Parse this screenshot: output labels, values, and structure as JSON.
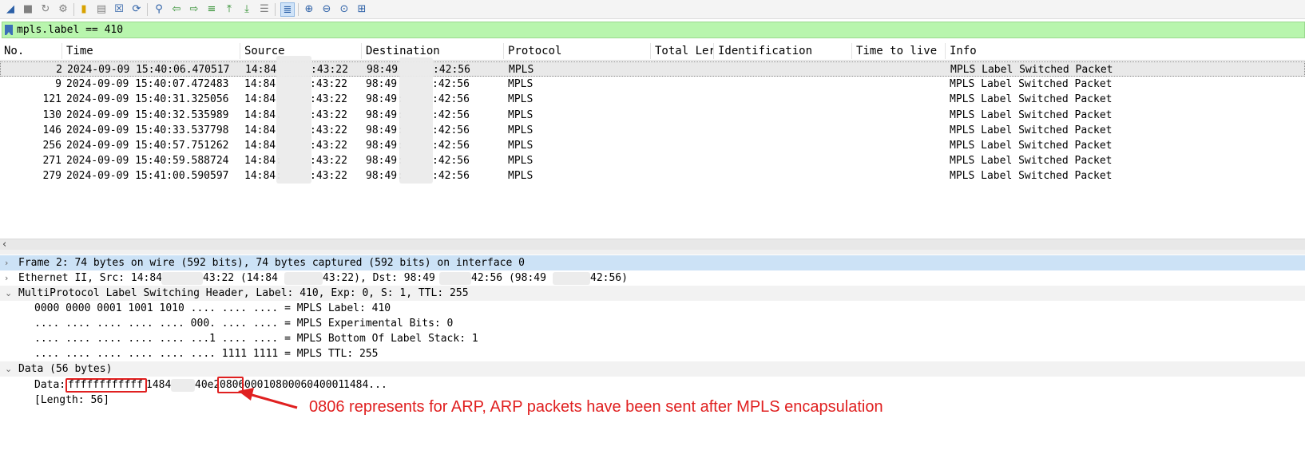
{
  "toolbar": {
    "icons": [
      "shark-fin-icon",
      "stop-icon",
      "restart-icon",
      "options-icon",
      "open-icon",
      "save-icon",
      "close-file-icon",
      "reload-icon",
      "find-icon",
      "back-icon",
      "forward-icon",
      "goto-icon",
      "first-icon",
      "last-icon",
      "autoscroll-icon",
      "colorize-icon",
      "zoom-in-icon",
      "zoom-out-icon",
      "zoom-normal-icon",
      "resize-columns-icon"
    ]
  },
  "filter": {
    "value": "mpls.label == 410"
  },
  "packet_list": {
    "columns": [
      "No.",
      "Time",
      "Source",
      "Destination",
      "Protocol",
      "Total Ler",
      "Identification",
      "Time to live",
      "Info"
    ],
    "rows": [
      {
        "no": "2",
        "time": "2024-09-09 15:40:06.470517",
        "src_a": "14:84",
        "src_b": ":43:22",
        "dst_a": "98:49",
        "dst_b": ":42:56",
        "proto": "MPLS",
        "info": "MPLS Label Switched Packet"
      },
      {
        "no": "9",
        "time": "2024-09-09 15:40:07.472483",
        "src_a": "14:84",
        "src_b": ":43:22",
        "dst_a": "98:49",
        "dst_b": ":42:56",
        "proto": "MPLS",
        "info": "MPLS Label Switched Packet"
      },
      {
        "no": "121",
        "time": "2024-09-09 15:40:31.325056",
        "src_a": "14:84",
        "src_b": ":43:22",
        "dst_a": "98:49:",
        "dst_b": ":42:56",
        "proto": "MPLS",
        "info": "MPLS Label Switched Packet"
      },
      {
        "no": "130",
        "time": "2024-09-09 15:40:32.535989",
        "src_a": "14:84.",
        "src_b": ":43:22",
        "dst_a": "98:49:",
        "dst_b": ":42:56",
        "proto": "MPLS",
        "info": "MPLS Label Switched Packet"
      },
      {
        "no": "146",
        "time": "2024-09-09 15:40:33.537798",
        "src_a": "14:84",
        "src_b": ":43:22",
        "dst_a": "98:49:",
        "dst_b": ":42:56",
        "proto": "MPLS",
        "info": "MPLS Label Switched Packet"
      },
      {
        "no": "256",
        "time": "2024-09-09 15:40:57.751262",
        "src_a": "14:84",
        "src_b": ":43:22",
        "dst_a": "98:49:",
        "dst_b": ":42:56",
        "proto": "MPLS",
        "info": "MPLS Label Switched Packet"
      },
      {
        "no": "271",
        "time": "2024-09-09 15:40:59.588724",
        "src_a": "14:84:",
        "src_b": ":43:22",
        "dst_a": "98:49:",
        "dst_b": ":42:56",
        "proto": "MPLS",
        "info": "MPLS Label Switched Packet"
      },
      {
        "no": "279",
        "time": "2024-09-09 15:41:00.590597",
        "src_a": "14:84:",
        "src_b": ":43:22",
        "dst_a": "98:49:",
        "dst_b": ":42:56",
        "proto": "MPLS",
        "info": "MPLS Label Switched Packet"
      }
    ]
  },
  "details": {
    "frame": "Frame 2: 74 bytes on wire (592 bits), 74 bytes captured (592 bits) on interface 0",
    "ethernet": {
      "p1": "Ethernet II, Src: 14:84",
      "p2": "43:22 (14:84",
      "p3": "43:22), Dst: 98:49",
      "p4": "42:56 (98:49",
      "p5": "42:56)"
    },
    "mpls": "MultiProtocol Label Switching Header, Label: 410, Exp: 0, S: 1, TTL: 255",
    "mpls_fields": [
      "0000 0000 0001 1001 1010 .... .... .... = MPLS Label: 410",
      ".... .... .... .... .... 000. .... .... = MPLS Experimental Bits: 0",
      ".... .... .... .... .... ...1 .... .... = MPLS Bottom Of Label Stack: 1",
      ".... .... .... .... .... .... 1111 1111 = MPLS TTL: 255"
    ],
    "data": "Data (56 bytes)",
    "data_line": {
      "label": "Data: ",
      "part1": "ffffffffffff",
      "part2": "1484",
      "part3": "40e2",
      "part4": "0806",
      "part5": "0001080006040001",
      "part6": "1484..."
    },
    "length": "[Length: 56]"
  },
  "annotation": "0806 represents for ARP, ARP packets have been sent after MPLS encapsulation",
  "colors": {
    "filter_bg": "#b8f5ad",
    "selected_detail": "#cce2f6",
    "annotation": "#e02020"
  }
}
